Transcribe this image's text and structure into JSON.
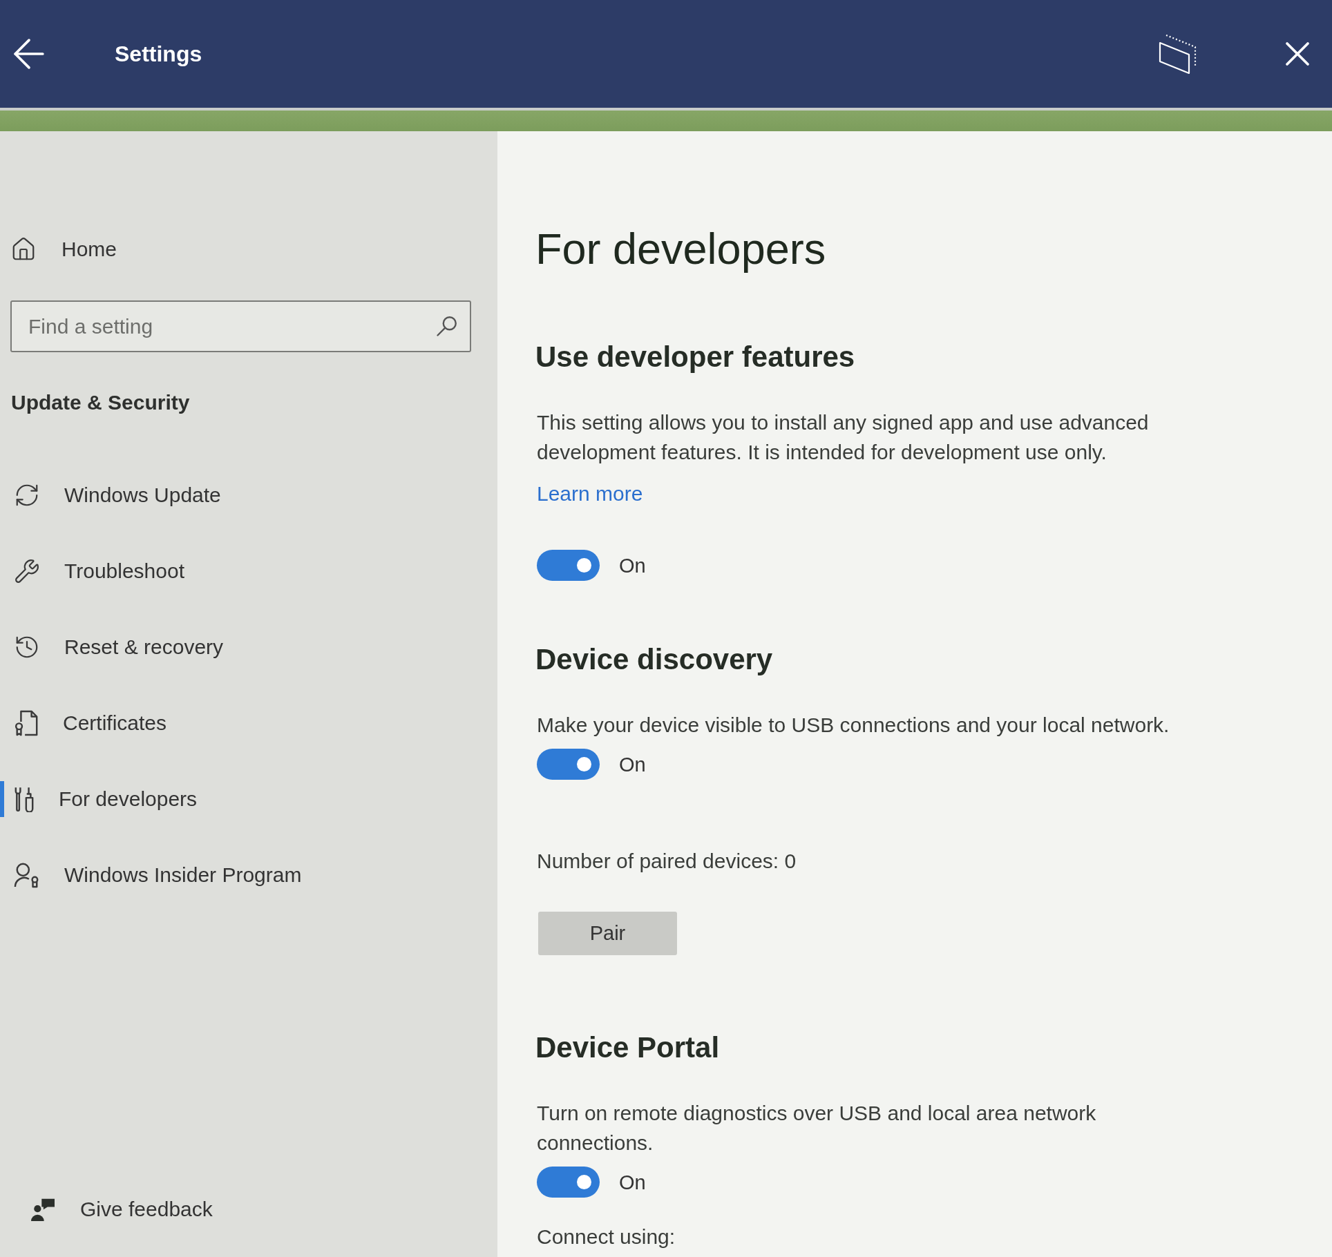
{
  "window": {
    "title": "Settings"
  },
  "sidebar": {
    "home": "Home",
    "search": {
      "placeholder": "Find a setting"
    },
    "section_title": "Update & Security",
    "items": [
      {
        "label": "Windows Update",
        "selected": false
      },
      {
        "label": "Troubleshoot",
        "selected": false
      },
      {
        "label": "Reset & recovery",
        "selected": false
      },
      {
        "label": "Certificates",
        "selected": false
      },
      {
        "label": "For developers",
        "selected": true
      },
      {
        "label": "Windows Insider Program",
        "selected": false
      }
    ],
    "feedback": "Give feedback"
  },
  "page": {
    "title": "For developers",
    "sections": [
      {
        "heading": "Use developer features",
        "description": "This setting allows you to install any signed app and use advanced development features. It is intended for development use only.",
        "link": "Learn more",
        "toggle": {
          "on": true,
          "label": "On"
        }
      },
      {
        "heading": "Device discovery",
        "description": "Make your device visible to USB connections and your local network.",
        "toggle": {
          "on": true,
          "label": "On"
        },
        "paired_devices": "Number of paired devices: 0",
        "button": "Pair"
      },
      {
        "heading": "Device Portal",
        "description": "Turn on remote diagnostics over USB and local area network connections.",
        "toggle": {
          "on": true,
          "label": "On"
        },
        "note": "Connect using:"
      }
    ]
  }
}
